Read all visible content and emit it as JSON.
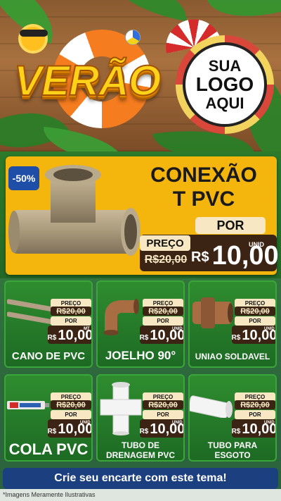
{
  "header": {
    "season_title": "VERÃO",
    "logo": {
      "line1": "SUA",
      "line2": "LOGO",
      "line3": "AQUI"
    }
  },
  "hero": {
    "discount_badge": "-50%",
    "title_line1": "CONEXÃO",
    "title_line2": "T PVC",
    "por_label": "POR",
    "preco_label": "PREÇO",
    "old_price": "R$20,00",
    "currency": "R$",
    "new_price": "10,00",
    "unit": "UNID"
  },
  "cards": [
    {
      "name": "CANO DE PVC",
      "preco_label": "PREÇO",
      "old_price": "R$20,00",
      "por_label": "POR",
      "currency": "R$",
      "new_price": "10,00",
      "unit": "MT",
      "icon": "pvc-pipe-icon"
    },
    {
      "name": "JOELHO 90°",
      "preco_label": "PREÇO",
      "old_price": "R$20,00",
      "por_label": "POR",
      "currency": "R$",
      "new_price": "10,00",
      "unit": "UNID",
      "icon": "elbow-fitting-icon"
    },
    {
      "name": "UNIAO SOLDAVEL",
      "preco_label": "PREÇO",
      "old_price": "R$20,00",
      "por_label": "POR",
      "currency": "R$",
      "new_price": "10,00",
      "unit": "UNID",
      "icon": "union-fitting-icon"
    },
    {
      "name": "COLA PVC",
      "preco_label": "PREÇO",
      "old_price": "R$20,00",
      "por_label": "POR",
      "currency": "R$",
      "new_price": "10,00",
      "unit": "UNID",
      "icon": "glue-tube-icon"
    },
    {
      "name_line1": "TUBO DE",
      "name_line2": "DRENAGEM PVC",
      "preco_label": "PREÇO",
      "old_price": "R$20,00",
      "por_label": "POR",
      "currency": "R$",
      "new_price": "10,00",
      "unit": "UNID",
      "icon": "drain-pipe-icon"
    },
    {
      "name_line1": "TUBO PARA",
      "name_line2": "ESGOTO",
      "preco_label": "PREÇO",
      "old_price": "R$20,00",
      "por_label": "POR",
      "currency": "R$",
      "new_price": "10,00",
      "unit": "UNID",
      "icon": "sewer-pipe-icon"
    }
  ],
  "footer": {
    "cta": "Crie seu encarte com este tema!",
    "disclaimer": "*Imagens Meramente Ilustrativas"
  },
  "colors": {
    "hero_bg": "#f4b50c",
    "price_box": "#3c2414",
    "price_label": "#f7e7c3",
    "badge": "#1f4ea8",
    "card_bg": "#2f8d2f",
    "cta_bg": "#1c3f7f"
  }
}
